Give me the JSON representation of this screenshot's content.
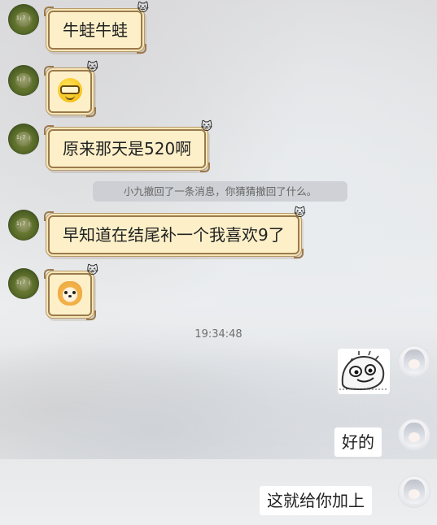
{
  "messages": [
    {
      "text": "牛蛙牛蛙"
    },
    {
      "sticker": "glasses-smile-emoji"
    },
    {
      "text": "原来那天是520啊"
    },
    {
      "text": "早知道在结尾补一个我喜欢9了"
    },
    {
      "sticker": "shiba-dog-sticker"
    }
  ],
  "system_note": "小九撤回了一条消息，你猜猜撤回了什么。",
  "timestamp": "19:34:48",
  "replies": [
    {
      "sticker": "sketch-doodle-sticker"
    },
    {
      "text": "好的"
    },
    {
      "text": "这就给你加上"
    }
  ]
}
